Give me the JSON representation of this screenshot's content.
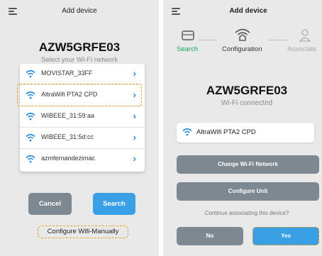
{
  "colors": {
    "accent": "#3aa0e6",
    "step_active": "#1aa35a",
    "highlight": "#f0a020",
    "button_gray": "#7e8891"
  },
  "left": {
    "title": "Add device",
    "device_id": "AZW5GRFE03",
    "subtitle": "Select your Wi-Fi network",
    "networks": [
      {
        "name": "MOVISTAR_33FF",
        "icon": "wifi-icon"
      },
      {
        "name": "AltraWifi PTA2 CPD",
        "icon": "wifi-icon",
        "highlighted": true
      },
      {
        "name": "WIBEEE_31:59:aa",
        "icon": "wifi-icon"
      },
      {
        "name": "WIBEEE_31:5d:cc",
        "icon": "wifi-icon"
      },
      {
        "name": "azmfernandezimac",
        "icon": "wifi-icon"
      }
    ],
    "cancel_label": "Cancel",
    "search_label": "Search",
    "manual_label": "Configure Wifi-Manually"
  },
  "right": {
    "title": "Add device",
    "steps": [
      {
        "label": "Search",
        "state": "done",
        "icon": "router-icon"
      },
      {
        "label": "Configuration",
        "state": "current",
        "icon": "wifi-home-icon"
      },
      {
        "label": "Associate",
        "state": "pending",
        "icon": "user-icon"
      }
    ],
    "device_id": "AZW5GRFE03",
    "status": "Wi-Fi connected",
    "selected_network": "AltraWifi PTA2 CPD",
    "change_label": "Change Wi-Fi Network",
    "configure_label": "Configure Unit",
    "question": "Continue associating this device?",
    "no_label": "No",
    "yes_label": "Yes"
  }
}
